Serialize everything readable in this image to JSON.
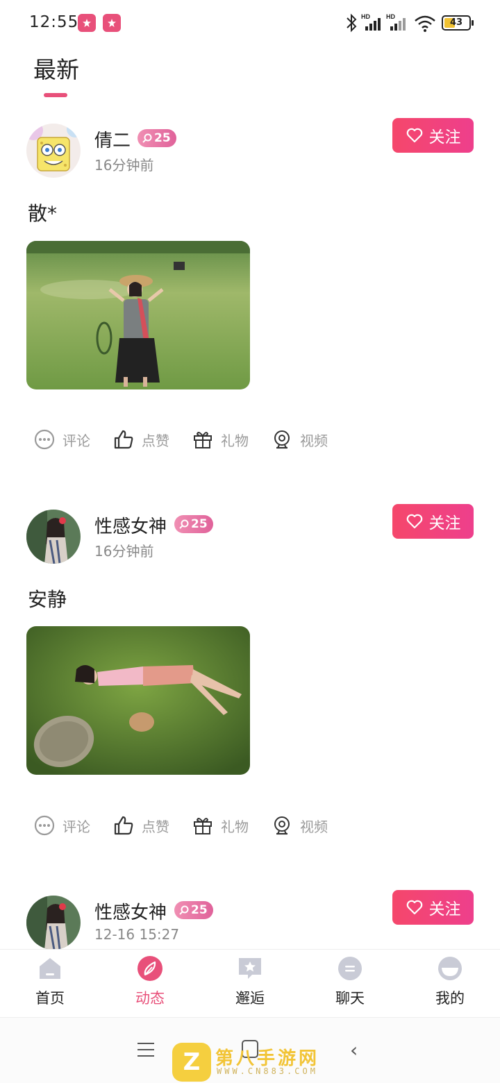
{
  "status_bar": {
    "time": "12:55",
    "battery": "43",
    "battery_level": 0.43
  },
  "header": {
    "tab": "最新"
  },
  "posts": [
    {
      "username": "倩二",
      "level": "25",
      "time": "16分钟前",
      "text": "散*",
      "follow_label": "关注"
    },
    {
      "username": "性感女神",
      "level": "25",
      "time": "16分钟前",
      "text": "安静",
      "follow_label": "关注"
    },
    {
      "username": "性感女神",
      "level": "25",
      "time": "12-16 15:27",
      "follow_label": "关注"
    }
  ],
  "actions": {
    "comment": "评论",
    "like": "点赞",
    "gift": "礼物",
    "video": "视频"
  },
  "nav": {
    "items": [
      {
        "label": "首页",
        "icon": "home-icon"
      },
      {
        "label": "动态",
        "icon": "compass-icon"
      },
      {
        "label": "邂逅",
        "icon": "star-message-icon"
      },
      {
        "label": "聊天",
        "icon": "chat-icon"
      },
      {
        "label": "我的",
        "icon": "profile-icon"
      }
    ],
    "active": "动态"
  },
  "watermark": {
    "title": "第八手游网",
    "url": "WWW.CN883.COM"
  },
  "colors": {
    "accent": "#e8507a",
    "follow_start": "#f5476b",
    "follow_end": "#ee3f8c",
    "badge": "#e0629a"
  }
}
